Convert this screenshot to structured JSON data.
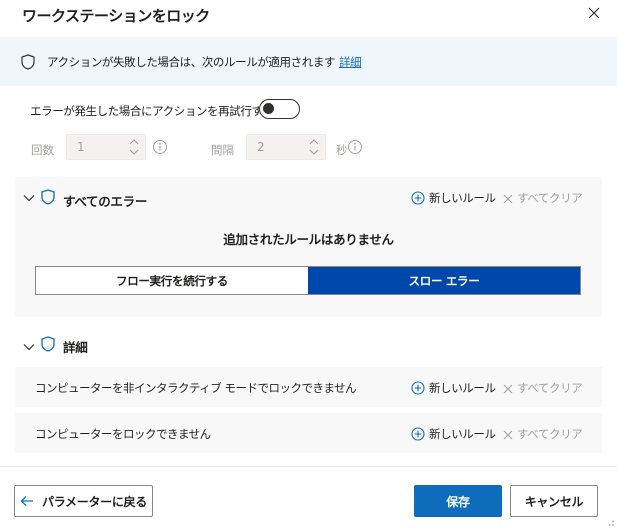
{
  "dialog": {
    "title": "ワークステーションをロック"
  },
  "info_banner": {
    "text": "アクションが失敗した場合は、次のルールが適用されます",
    "link": "詳細"
  },
  "retry": {
    "label": "エラーが発生した場合にアクションを再試行する",
    "enabled": false,
    "count_label": "回数",
    "count_value": "1",
    "interval_label": "間隔",
    "interval_value": "2",
    "unit": "秒"
  },
  "all_errors": {
    "title": "すべてのエラー",
    "add_rule": "新しいルール",
    "clear_all": "すべてクリア",
    "empty_message": "追加されたルールはありません",
    "options": [
      "フロー実行を続行する",
      "スロー エラー"
    ],
    "selected": "スロー エラー"
  },
  "details": {
    "title": "詳細",
    "rows": [
      {
        "label": "コンピューターを非インタラクティブ モードでロックできません",
        "add_rule": "新しいルール",
        "clear_all": "すべてクリア"
      },
      {
        "label": "コンピューターをロックできません",
        "add_rule": "新しいルール",
        "clear_all": "すべてクリア"
      }
    ]
  },
  "footer": {
    "back": "パラメーターに戻る",
    "save": "保存",
    "cancel": "キャンセル"
  },
  "colors": {
    "accent": "#0f6cbd",
    "selected_segment": "#0047ab",
    "banner_bg": "#eff6fc",
    "panel_bg": "#f8f8f8"
  }
}
